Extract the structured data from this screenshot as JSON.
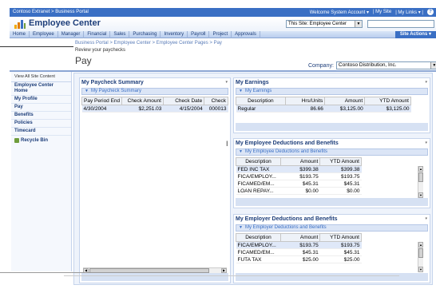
{
  "topbar": {
    "breadcrumb": "Contoso Extranet > Business Portal",
    "welcome": "Welcome System Account ▾",
    "my_site": "| My Site",
    "my_links": "| My Links ▾ |"
  },
  "header": {
    "site_title": "Employee Center",
    "search_scope": "This Site: Employee Center"
  },
  "nav": {
    "tabs": [
      "Home",
      "Employee",
      "Manager",
      "Financial",
      "Sales",
      "Purchasing",
      "Inventory",
      "Payroll",
      "Project",
      "Approvals"
    ],
    "site_actions": "Site Actions ▾"
  },
  "page": {
    "breadcrumb": "Business Portal > Employee Center > Employee Center Pages > Pay",
    "description": "Review your paychecks",
    "title": "Pay",
    "company_label": "Company:",
    "company_value": "Contoso Distribution, Inc."
  },
  "sidebar": {
    "view_all": "View All Site Content",
    "items": [
      "Employee Center Home",
      "My Profile",
      "Pay",
      "Benefits",
      "Policies",
      "Timecard"
    ],
    "recycle": "Recycle Bin"
  },
  "paycheck": {
    "title": "My Paycheck Summary",
    "bar": "My Paycheck Summary",
    "columns": [
      "Pay Period End",
      "Check Amount",
      "Check Date",
      "Check"
    ],
    "rows": [
      [
        "4/30/2004",
        "$2,251.03",
        "4/15/2004",
        "000013"
      ]
    ]
  },
  "earnings": {
    "title": "My Earnings",
    "bar": "My Earnings",
    "columns": [
      "Description",
      "Hrs/Units",
      "Amount",
      "YTD Amount"
    ],
    "rows": [
      [
        "Regular",
        "86.66",
        "$3,125.00",
        "$3,125.00"
      ]
    ]
  },
  "deductions": {
    "title": "My Employee Deductions and Benefits",
    "bar": "My Employee Deductions and Benefits",
    "columns": [
      "Description",
      "Amount",
      "YTD Amount"
    ],
    "rows": [
      [
        "FED INC TAX",
        "$399.38",
        "$399.38"
      ],
      [
        "FICA/EMPLOY...",
        "$193.75",
        "$193.75"
      ],
      [
        "FICAMED/EM...",
        "$45.31",
        "$45.31"
      ],
      [
        "LOAN REPAY...",
        "$0.00",
        "$0.00"
      ]
    ]
  },
  "employer": {
    "title": "My Employer Deductions and Benefits",
    "bar": "My Employer Deductions and Benefits",
    "columns": [
      "Description",
      "Amount",
      "YTD Amount"
    ],
    "rows": [
      [
        "FICA/EMPLOY...",
        "$193.75",
        "$193.75"
      ],
      [
        "FICAMED/EM...",
        "$45.31",
        "$45.31"
      ],
      [
        "FUTA TAX",
        "$25.00",
        "$25.00"
      ]
    ]
  }
}
